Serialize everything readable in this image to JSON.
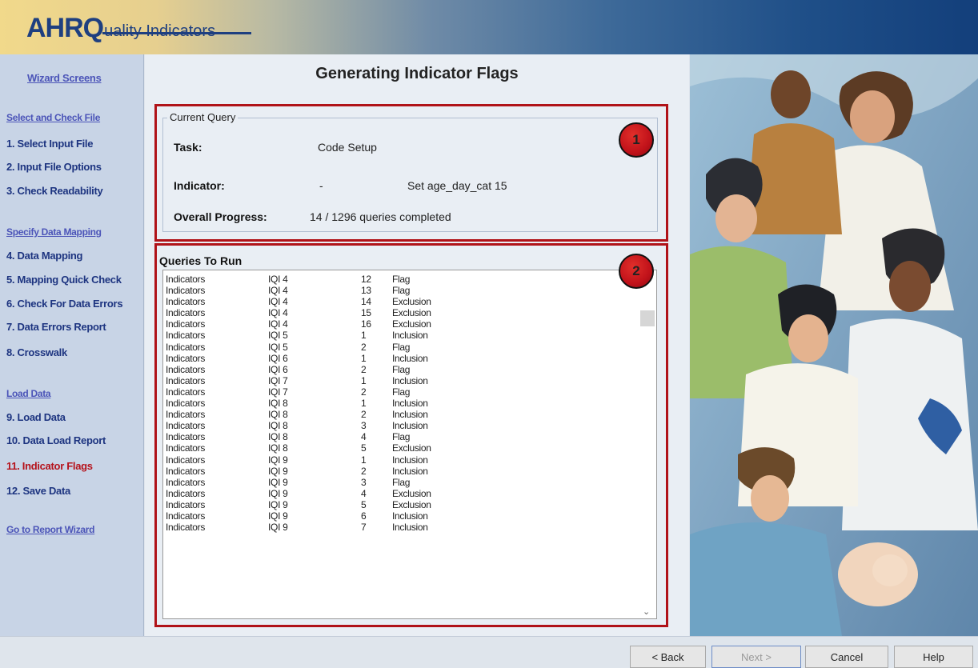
{
  "header": {
    "logo_main": "AHRQ",
    "logo_sub": "uality Indicators"
  },
  "sidebar": {
    "title": "Wizard Screens",
    "items": [
      {
        "label": "Select and Check File",
        "kind": "section"
      },
      {
        "label": "1. Select Input File",
        "kind": "item"
      },
      {
        "label": "2. Input File Options",
        "kind": "item"
      },
      {
        "label": "3. Check Readability",
        "kind": "item"
      },
      {
        "label": "Specify Data Mapping",
        "kind": "section"
      },
      {
        "label": "4. Data Mapping",
        "kind": "item"
      },
      {
        "label": "5. Mapping Quick Check",
        "kind": "item"
      },
      {
        "label": "6. Check For Data Errors",
        "kind": "item"
      },
      {
        "label": "7. Data Errors Report",
        "kind": "item"
      },
      {
        "label": "8. Crosswalk",
        "kind": "item"
      },
      {
        "label": "Load Data",
        "kind": "section"
      },
      {
        "label": "9. Load Data",
        "kind": "item"
      },
      {
        "label": "10. Data Load Report",
        "kind": "item"
      },
      {
        "label": "11. Indicator Flags",
        "kind": "active"
      },
      {
        "label": "12. Save Data",
        "kind": "item"
      },
      {
        "label": "Go to Report Wizard",
        "kind": "section"
      }
    ]
  },
  "main": {
    "title": "Generating Indicator Flags",
    "current_query": {
      "legend": "Current Query",
      "task_label": "Task:",
      "task_value": "Code Setup",
      "indicator_label": "Indicator:",
      "indicator_value": "-",
      "indicator_detail": "Set age_day_cat 15",
      "progress_label": "Overall Progress:",
      "progress_value": "14 / 1296 queries completed"
    },
    "queries_title": "Queries To Run",
    "queries": [
      [
        "Indicators",
        "IQI 4",
        "12",
        "Flag"
      ],
      [
        "Indicators",
        "IQI 4",
        "13",
        "Flag"
      ],
      [
        "Indicators",
        "IQI 4",
        "14",
        "Exclusion"
      ],
      [
        "Indicators",
        "IQI 4",
        "15",
        "Exclusion"
      ],
      [
        "Indicators",
        "IQI 4",
        "16",
        "Exclusion"
      ],
      [
        "Indicators",
        "IQI 5",
        "1",
        "Inclusion"
      ],
      [
        "Indicators",
        "IQI 5",
        "2",
        "Flag"
      ],
      [
        "Indicators",
        "IQI 6",
        "1",
        "Inclusion"
      ],
      [
        "Indicators",
        "IQI 6",
        "2",
        "Flag"
      ],
      [
        "Indicators",
        "IQI 7",
        "1",
        "Inclusion"
      ],
      [
        "Indicators",
        "IQI 7",
        "2",
        "Flag"
      ],
      [
        "Indicators",
        "IQI 8",
        "1",
        "Inclusion"
      ],
      [
        "Indicators",
        "IQI 8",
        "2",
        "Inclusion"
      ],
      [
        "Indicators",
        "IQI 8",
        "3",
        "Inclusion"
      ],
      [
        "Indicators",
        "IQI 8",
        "4",
        "Flag"
      ],
      [
        "Indicators",
        "IQI 8",
        "5",
        "Exclusion"
      ],
      [
        "Indicators",
        "IQI 9",
        "1",
        "Inclusion"
      ],
      [
        "Indicators",
        "IQI 9",
        "2",
        "Inclusion"
      ],
      [
        "Indicators",
        "IQI 9",
        "3",
        "Flag"
      ],
      [
        "Indicators",
        "IQI 9",
        "4",
        "Exclusion"
      ],
      [
        "Indicators",
        "IQI 9",
        "5",
        "Exclusion"
      ],
      [
        "Indicators",
        "IQI 9",
        "6",
        "Inclusion"
      ],
      [
        "Indicators",
        "IQI 9",
        "7",
        "Inclusion"
      ]
    ],
    "markers": [
      "1",
      "2"
    ]
  },
  "buttons": {
    "back": "< Back",
    "next": "Next >",
    "cancel": "Cancel",
    "help": "Help"
  },
  "colors": {
    "accent_red": "#b01218",
    "nav_blue": "#1d3480",
    "active_red": "#b5121b"
  },
  "icons": {
    "scroll_down": "chevron-down-icon"
  }
}
